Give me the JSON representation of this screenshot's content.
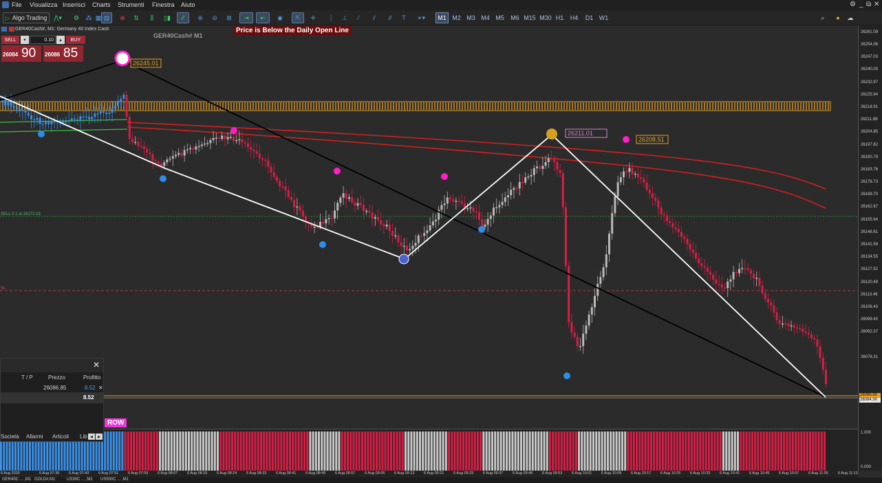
{
  "menu": {
    "items": [
      "File",
      "Visualizza",
      "Inserisci",
      "Charts",
      "Strumenti",
      "Finestra",
      "Aiuto"
    ],
    "window_controls": [
      "⚙",
      "_",
      "⧉",
      "✕"
    ]
  },
  "toolbar": {
    "algo_trading_label": "Algo Trading",
    "timeframes": [
      "M1",
      "M2",
      "M3",
      "M4",
      "M5",
      "M6",
      "M15",
      "M30",
      "H1",
      "H4",
      "D1",
      "W1"
    ],
    "selected_timeframe": "M1"
  },
  "chart": {
    "header": "GER40Cash#, M1:  Germany 40 Index Cash",
    "watermark": "GER40Cash# M1",
    "alert": "Price is Below the Daily Open Line",
    "labels": {
      "high_left": "26245.01",
      "high_mid": "26211.01",
      "high_right": "26208.51",
      "sell_order": "SELL 0.1 at 26172.03",
      "sl": "SL"
    }
  },
  "trade_panel": {
    "sell_label": "SELL",
    "buy_label": "BUY",
    "lot": "0.10",
    "bid_small": "26084",
    "bid_big": "90",
    "ask_small": "26086",
    "ask_big": "85"
  },
  "terminal": {
    "columns": [
      "T / P",
      "Prezzo",
      "Profitto"
    ],
    "row": {
      "price": "26086.85",
      "profit": "8.52"
    },
    "total_profit": "8.52",
    "tabs": [
      "Società",
      "Allarmi",
      "Articoli",
      "Lib"
    ]
  },
  "indicator_label": "ROW",
  "price_axis": {
    "labels": [
      "26261.09",
      "26254.06",
      "26247.03",
      "26240.00",
      "26232.97",
      "26225.94",
      "26218.91",
      "26211.88",
      "26204.85",
      "26197.82",
      "26190.79",
      "26183.76",
      "26176.73",
      "26169.70",
      "26162.67",
      "26155.64",
      "26148.61",
      "26141.58",
      "26134.55",
      "26127.52",
      "26120.49",
      "26113.46",
      "26106.43",
      "26099.40",
      "26092.37",
      "26078.31"
    ],
    "tag_ask": "26086.85",
    "tag_bid": "26084.90",
    "sub_high": "1.000",
    "sub_low": "0.000"
  },
  "time_axis": [
    "6 Aug 2026",
    "6 Aug 07:35",
    "6 Aug 07:43",
    "6 Aug 07:51",
    "6 Aug 07:59",
    "6 Aug 08:07",
    "6 Aug 08:15",
    "6 Aug 08:24",
    "6 Aug 08:33",
    "6 Aug 08:41",
    "6 Aug 08:49",
    "6 Aug 08:57",
    "6 Aug 09:05",
    "6 Aug 09:13",
    "6 Aug 09:21",
    "6 Aug 09:29",
    "6 Aug 09:37",
    "6 Aug 09:45",
    "6 Aug 09:53",
    "6 Aug 10:01",
    "6 Aug 10:09",
    "6 Aug 10:17",
    "6 Aug 10:25",
    "6 Aug 10:33",
    "6 Aug 10:41",
    "6 Aug 10:49",
    "6 Aug 10:57",
    "6 Aug 11:05",
    "6 Aug 11:13"
  ],
  "bottom_tabs": [
    "GER40C ... ,M1",
    "GOLD#,M1",
    "US30C ... ,M1",
    "US500C ... ,M1"
  ],
  "colors": {
    "bull_candle": "#b9b9b9",
    "bear_candle": "#d61f45",
    "blue_candle": "#3a8fe6",
    "ma": "#d42020",
    "zone": "#e8a020"
  }
}
